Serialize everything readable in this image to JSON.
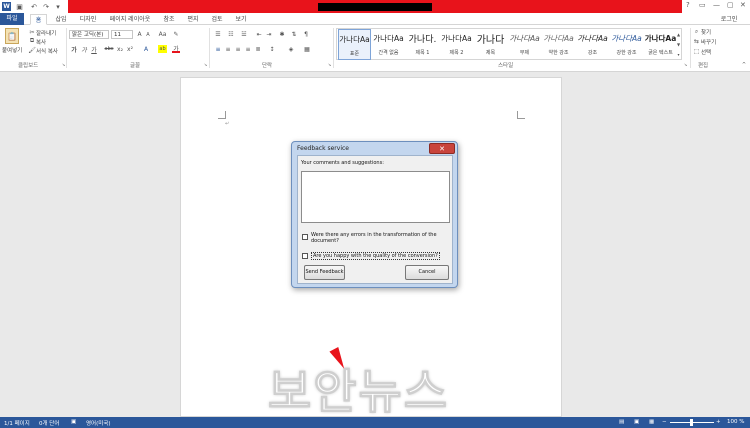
{
  "window": {
    "controls": {
      "help": "?",
      "restore": "▭",
      "minimize": "—",
      "close": "✕"
    },
    "login": "로그인"
  },
  "tabs": [
    {
      "label": "파일"
    },
    {
      "label": "홈"
    },
    {
      "label": "삽입"
    },
    {
      "label": "디자인"
    },
    {
      "label": "페이지 레이아웃"
    },
    {
      "label": "참조"
    },
    {
      "label": "편지"
    },
    {
      "label": "검토"
    },
    {
      "label": "보기"
    }
  ],
  "ribbon": {
    "clipboard": {
      "paste": "붙여넣기",
      "cut": "잘라내기",
      "copy": "복사",
      "format_painter": "서식 복사",
      "group_label": "클립보드"
    },
    "font": {
      "font_name": "맑은 고딕(본)",
      "font_size": "11",
      "grow": "A",
      "shrink": "A",
      "case": "Aa",
      "clear": "✎",
      "bold": "가",
      "italic": "가",
      "underline": "가",
      "strike": "abc",
      "subscript": "x₂",
      "superscript": "x²",
      "text_effects": "A",
      "highlight": "ab",
      "font_color": "가",
      "group_label": "글꼴"
    },
    "paragraph": {
      "group_label": "단락"
    },
    "styles": {
      "group_label": "스타일",
      "items": [
        {
          "sample": "가나다Aa",
          "name": "표준"
        },
        {
          "sample": "가나다Aa",
          "name": "간격 없음"
        },
        {
          "sample": "가나다.",
          "name": "제목 1"
        },
        {
          "sample": "가나다Aa",
          "name": "제목 2"
        },
        {
          "sample": "가나다",
          "name": "제목"
        },
        {
          "sample": "가나다Aa",
          "name": "부제"
        },
        {
          "sample": "가나다Aa",
          "name": "약한 강조"
        },
        {
          "sample": "가나다Aa",
          "name": "강조"
        },
        {
          "sample": "가나다Aa",
          "name": "강한 강조"
        },
        {
          "sample": "가나다Aa",
          "name": "굵은 텍스트"
        }
      ]
    },
    "editing": {
      "find": "찾기",
      "replace": "바꾸기",
      "select": "선택",
      "group_label": "편집"
    }
  },
  "dialog": {
    "title": "Feedback service",
    "close": "✕",
    "prompt": "Your comments and suggestions:",
    "textarea_value": "",
    "check1_line1": "Were there any errors in the transformation of the",
    "check1_line2": "document?",
    "check2": "Are you happy with the quality of the conversion?",
    "send": "Send Feedback",
    "cancel": "Cancel"
  },
  "watermark": "보안뉴스",
  "status": {
    "page": "1/1 페이지",
    "words": "0개 단어",
    "language": "영어(미국)",
    "zoom_minus": "−",
    "zoom_plus": "+",
    "zoom": "100 %"
  },
  "colors": {
    "accent": "#2b579a",
    "redacted_bar": "#e8131b",
    "dialog_close": "#c9443c"
  }
}
